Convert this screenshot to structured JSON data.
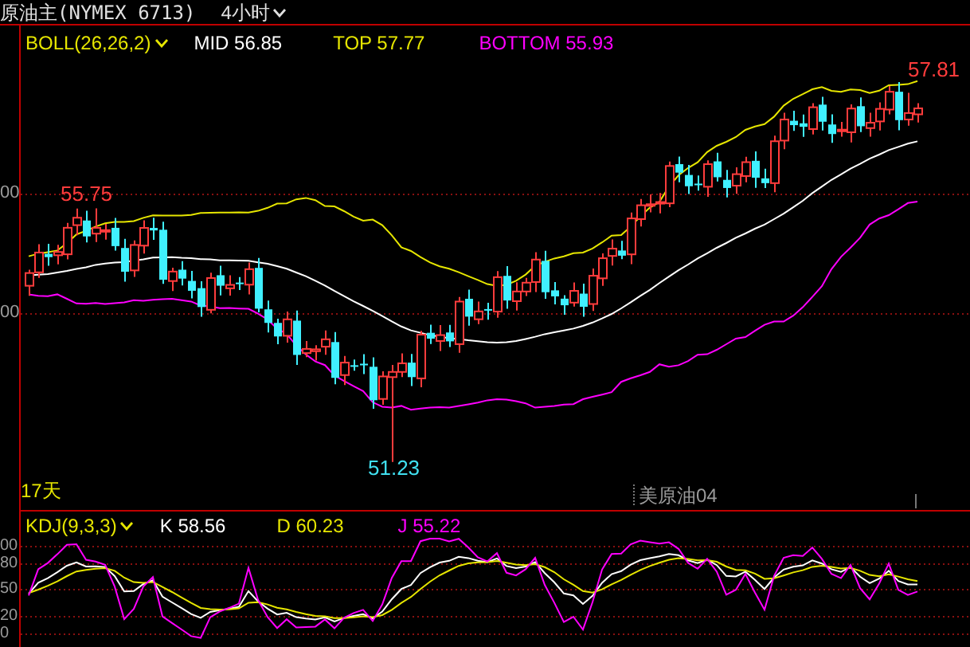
{
  "header": {
    "title": "原油主(NYMEX 6713)",
    "period": "4小时"
  },
  "main_panel": {
    "indicator": "BOLL(26,26,2)",
    "readings": [
      {
        "label": "MID 56.85",
        "color": "#ffffff"
      },
      {
        "label": "TOP 57.77",
        "color": "#e6e600"
      },
      {
        "label": "BOTTOM 55.93",
        "color": "#ff00ff"
      }
    ],
    "y_axis_labels": [
      "00",
      "00"
    ],
    "annotations": [
      {
        "text": "55.75",
        "color": "#ff3c3c"
      },
      {
        "text": "57.81",
        "color": "#ff3c3c"
      },
      {
        "text": "51.23",
        "color": "#40e0f0"
      }
    ],
    "span_label": "17天",
    "contract_label": "美原油04"
  },
  "kdj_panel": {
    "indicator": "KDJ(9,3,3)",
    "readings": [
      {
        "label": "K 58.56",
        "color": "#ffffff"
      },
      {
        "label": "D 60.23",
        "color": "#e6e600"
      },
      {
        "label": "J 55.22",
        "color": "#ff00ff"
      }
    ],
    "y_axis_labels": [
      "00",
      "80",
      "50",
      "20",
      "0"
    ]
  }
}
